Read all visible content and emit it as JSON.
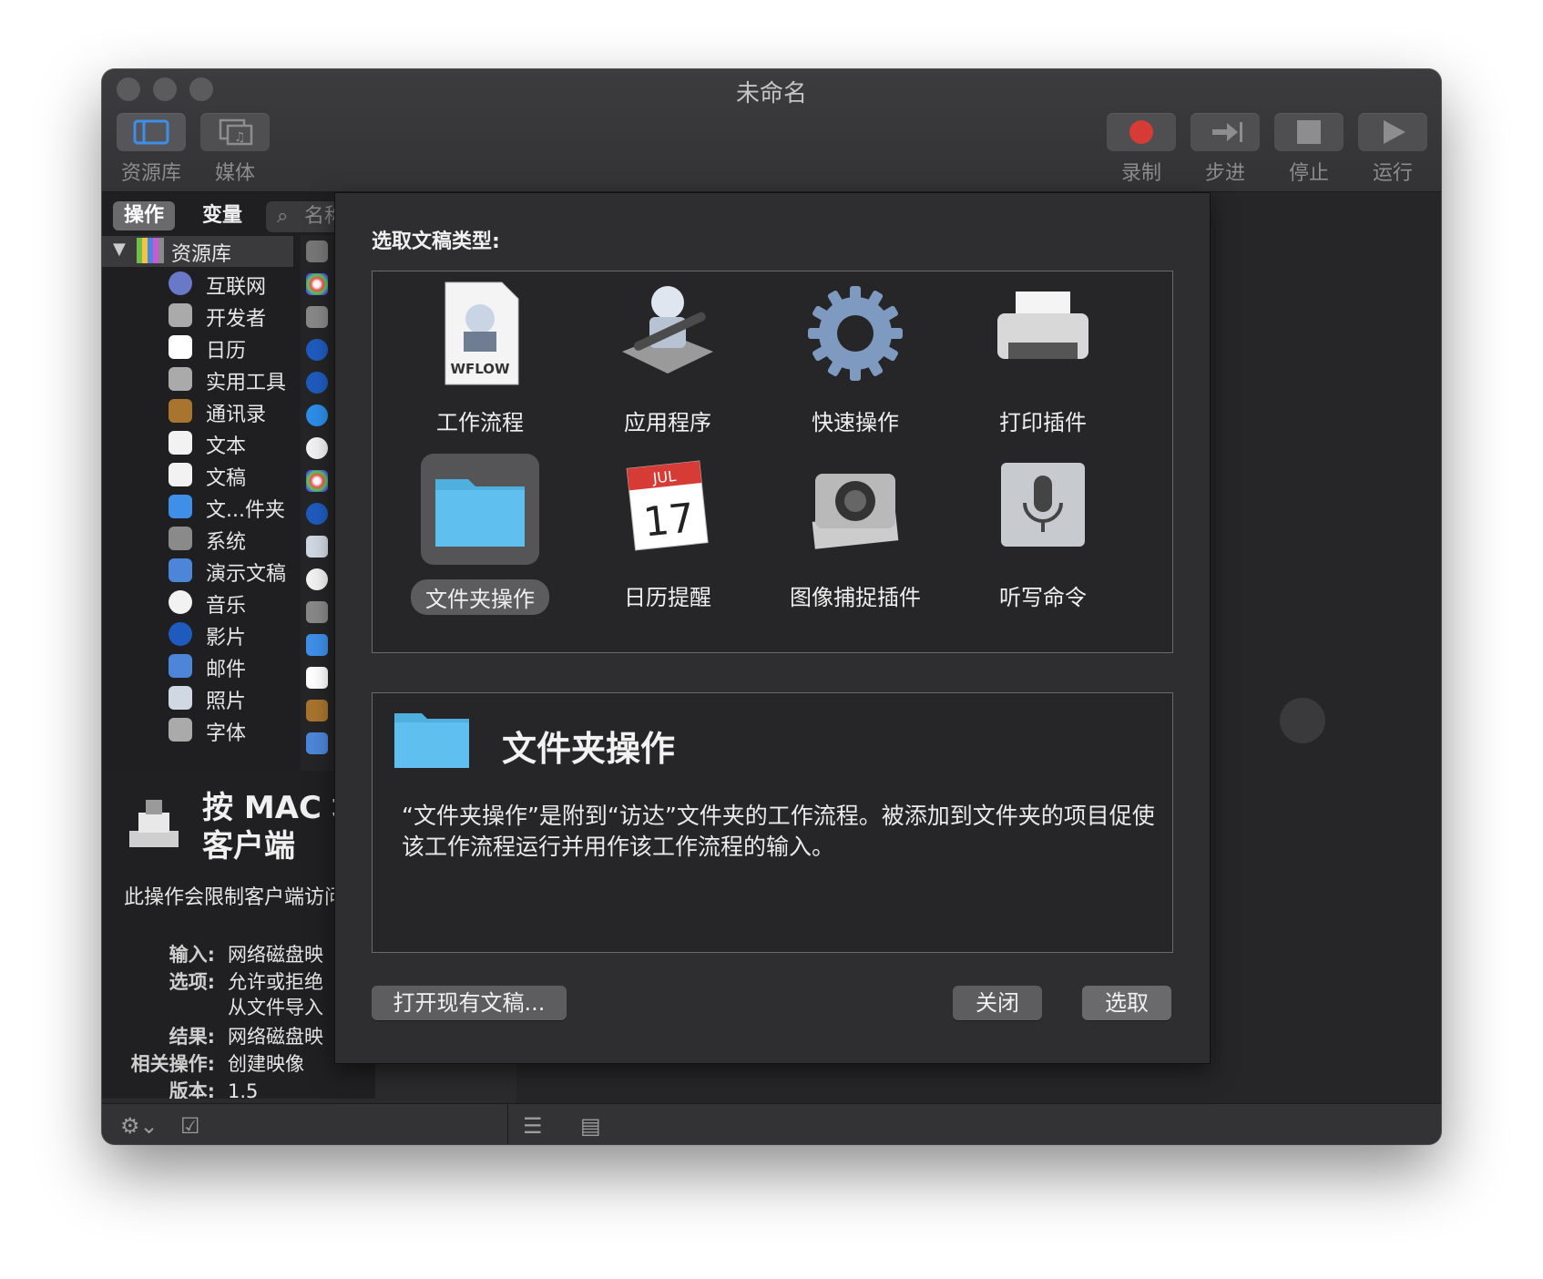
{
  "window": {
    "title": "未命名"
  },
  "toolbar": {
    "library": "资源库",
    "media": "媒体",
    "record": "录制",
    "step": "步进",
    "stop": "停止",
    "run": "运行"
  },
  "sidebar": {
    "tab_actions": "操作",
    "tab_variables": "变量",
    "search_placeholder": "名称",
    "library_root": "资源库",
    "items": [
      {
        "label": "互联网",
        "icon": "globe-icon"
      },
      {
        "label": "开发者",
        "icon": "tools-icon"
      },
      {
        "label": "日历",
        "icon": "calendar-icon"
      },
      {
        "label": "实用工具",
        "icon": "tools-icon"
      },
      {
        "label": "通讯录",
        "icon": "contacts-icon"
      },
      {
        "label": "文本",
        "icon": "text-icon"
      },
      {
        "label": "文稿",
        "icon": "document-icon"
      },
      {
        "label": "文...件夹",
        "icon": "finder-icon"
      },
      {
        "label": "系统",
        "icon": "system-icon"
      },
      {
        "label": "演示文稿",
        "icon": "keynote-icon"
      },
      {
        "label": "音乐",
        "icon": "music-icon"
      },
      {
        "label": "影片",
        "icon": "movie-icon"
      },
      {
        "label": "邮件",
        "icon": "mail-icon"
      },
      {
        "label": "照片",
        "icon": "photos-icon"
      },
      {
        "label": "字体",
        "icon": "font-icon"
      }
    ]
  },
  "info": {
    "title_line1": "按 MAC 地",
    "title_line2": "客户端",
    "description": "此操作会限制客户端访问映像。",
    "input_label": "输入:",
    "input_value": "网络磁盘映",
    "options_label": "选项:",
    "options_value1": "允许或拒绝",
    "options_value2": "从文件导入",
    "result_label": "结果:",
    "result_value": "网络磁盘映",
    "related_label": "相关操作:",
    "related_value": "创建映像",
    "version_label": "版本:",
    "version_value": "1.5"
  },
  "sheet": {
    "prompt": "选取文稿类型:",
    "types": [
      {
        "label": "工作流程",
        "icon": "workflow-icon",
        "badge": "WFLOW"
      },
      {
        "label": "应用程序",
        "icon": "automator-robot-icon"
      },
      {
        "label": "快速操作",
        "icon": "gear-icon"
      },
      {
        "label": "打印插件",
        "icon": "printer-icon"
      },
      {
        "label": "文件夹操作",
        "icon": "folder-icon"
      },
      {
        "label": "日历提醒",
        "icon": "calendar-icon",
        "month": "JUL",
        "day": "17"
      },
      {
        "label": "图像捕捉插件",
        "icon": "camera-icon"
      },
      {
        "label": "听写命令",
        "icon": "microphone-icon"
      }
    ],
    "selected_title": "文件夹操作",
    "selected_description": "“文件夹操作”是附到“访达”文件夹的工作流程。被添加到文件夹的项目促使该工作流程运行并用作该工作流程的输入。",
    "open_existing": "打开现有文稿...",
    "close": "关闭",
    "choose": "选取"
  },
  "colors": {
    "record_red": "#d63b35",
    "folder_blue": "#4fb0e0",
    "window_bg": "#2b2b2d"
  }
}
